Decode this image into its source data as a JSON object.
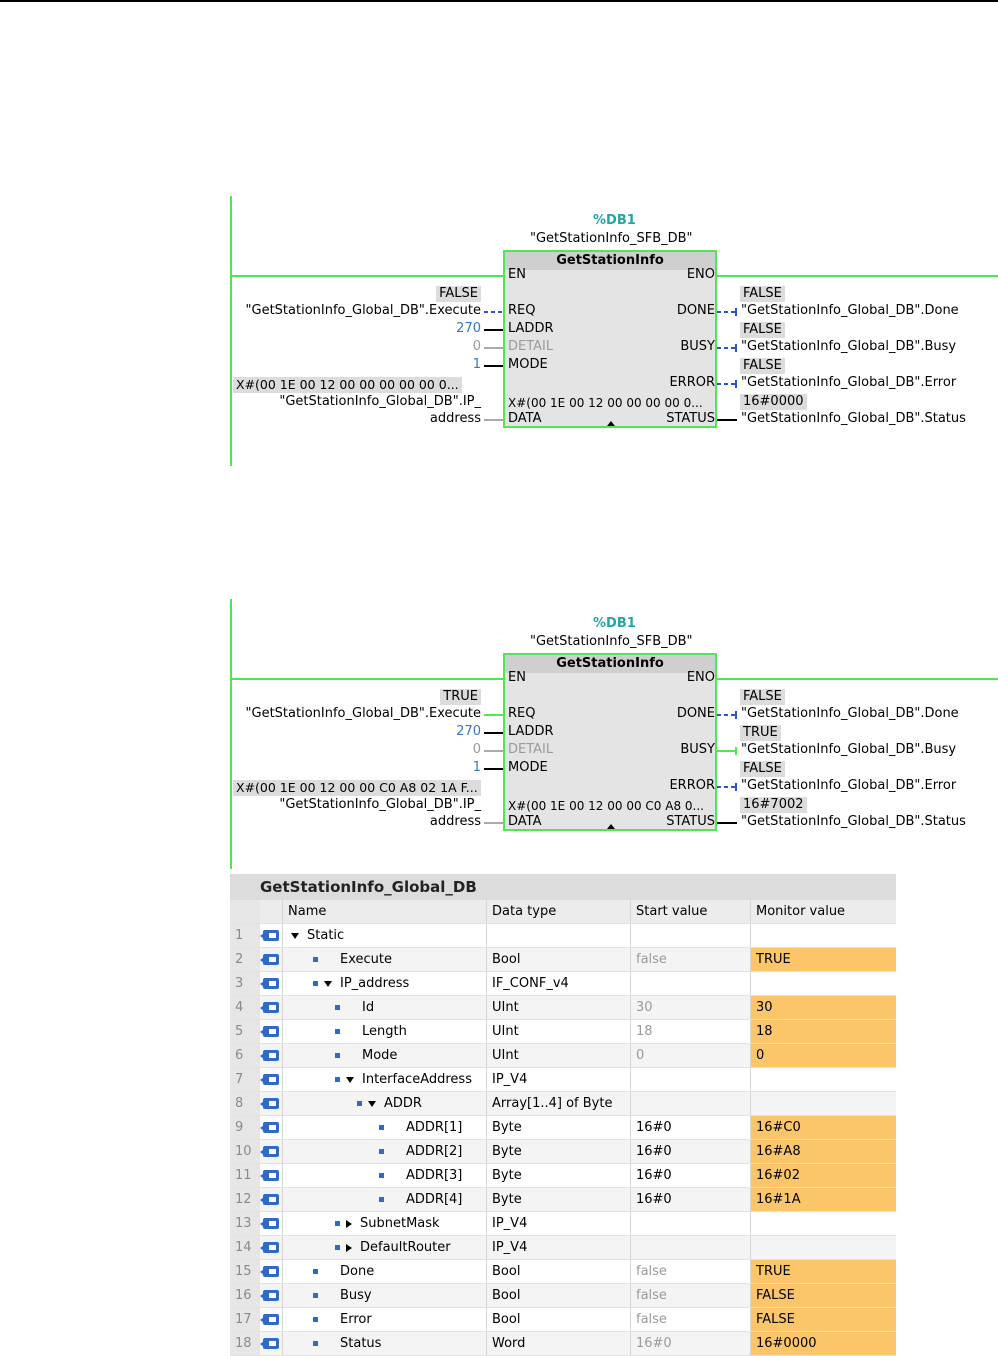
{
  "networks": [
    {
      "instance_addr": "%DB1",
      "instance_name": "\"GetStationInfo_SFB_DB\"",
      "block_title": "GetStationInfo",
      "en": "EN",
      "eno": "ENO",
      "pins_in": {
        "req": "REQ",
        "laddr": "LADDR",
        "detail": "DETAIL",
        "mode": "MODE",
        "data": "DATA"
      },
      "pins_out": {
        "done": "DONE",
        "busy": "BUSY",
        "error": "ERROR",
        "status": "STATUS"
      },
      "req_value": "FALSE",
      "req_tag": "\"GetStationInfo_Global_DB\".Execute",
      "laddr_value": "270",
      "detail_value": "0",
      "mode_value": "1",
      "data_value": "X#(00 1E 00 12 00 00 00 00 00 0...",
      "data_tag_line1": "\"GetStationInfo_Global_DB\".IP_",
      "data_tag_line2": "address",
      "data_inner": "X#(00 1E 00 12 00 00 00 00 0...",
      "done_value": "FALSE",
      "done_tag": "\"GetStationInfo_Global_DB\".Done",
      "busy_value": "FALSE",
      "busy_tag": "\"GetStationInfo_Global_DB\".Busy",
      "error_value": "FALSE",
      "error_tag": "\"GetStationInfo_Global_DB\".Error",
      "status_value": "16#0000",
      "status_tag": "\"GetStationInfo_Global_DB\".Status"
    },
    {
      "instance_addr": "%DB1",
      "instance_name": "\"GetStationInfo_SFB_DB\"",
      "block_title": "GetStationInfo",
      "en": "EN",
      "eno": "ENO",
      "pins_in": {
        "req": "REQ",
        "laddr": "LADDR",
        "detail": "DETAIL",
        "mode": "MODE",
        "data": "DATA"
      },
      "pins_out": {
        "done": "DONE",
        "busy": "BUSY",
        "error": "ERROR",
        "status": "STATUS"
      },
      "req_value": "TRUE",
      "req_tag": "\"GetStationInfo_Global_DB\".Execute",
      "laddr_value": "270",
      "detail_value": "0",
      "mode_value": "1",
      "data_value": "X#(00 1E 00 12 00 00 C0 A8 02 1A F...",
      "data_tag_line1": "\"GetStationInfo_Global_DB\".IP_",
      "data_tag_line2": "address",
      "data_inner": "X#(00 1E 00 12 00 00 C0 A8 0...",
      "done_value": "FALSE",
      "done_tag": "\"GetStationInfo_Global_DB\".Done",
      "busy_value": "TRUE",
      "busy_tag": "\"GetStationInfo_Global_DB\".Busy",
      "error_value": "FALSE",
      "error_tag": "\"GetStationInfo_Global_DB\".Error",
      "status_value": "16#7002",
      "status_tag": "\"GetStationInfo_Global_DB\".Status"
    }
  ],
  "table": {
    "title": "GetStationInfo_Global_DB",
    "headers": {
      "name": "Name",
      "type": "Data type",
      "start": "Start value",
      "monitor": "Monitor value"
    },
    "rows": [
      {
        "n": "1",
        "name": "Static",
        "type": "",
        "start": "",
        "monitor": "",
        "level": 0,
        "marker": "down",
        "bullet": false
      },
      {
        "n": "2",
        "name": "Execute",
        "type": "Bool",
        "start": "false",
        "monitor": "TRUE",
        "level": 1,
        "marker": "",
        "bullet": true
      },
      {
        "n": "3",
        "name": "IP_address",
        "type": "IF_CONF_v4",
        "start": "",
        "monitor": "",
        "level": 1,
        "marker": "down",
        "bullet": true
      },
      {
        "n": "4",
        "name": "Id",
        "type": "UInt",
        "start": "30",
        "monitor": "30",
        "level": 2,
        "marker": "",
        "bullet": true
      },
      {
        "n": "5",
        "name": "Length",
        "type": "UInt",
        "start": "18",
        "monitor": "18",
        "level": 2,
        "marker": "",
        "bullet": true
      },
      {
        "n": "6",
        "name": "Mode",
        "type": "UInt",
        "start": "0",
        "monitor": "0",
        "level": 2,
        "marker": "",
        "bullet": true
      },
      {
        "n": "7",
        "name": "InterfaceAddress",
        "type": "IP_V4",
        "start": "",
        "monitor": "",
        "level": 2,
        "marker": "down",
        "bullet": true
      },
      {
        "n": "8",
        "name": "ADDR",
        "type": "Array[1..4] of Byte",
        "start": "",
        "monitor": "",
        "level": 3,
        "marker": "down",
        "bullet": true
      },
      {
        "n": "9",
        "name": "ADDR[1]",
        "type": "Byte",
        "start": "16#0",
        "monitor": "16#C0",
        "level": 4,
        "marker": "",
        "bullet": true
      },
      {
        "n": "10",
        "name": "ADDR[2]",
        "type": "Byte",
        "start": "16#0",
        "monitor": "16#A8",
        "level": 4,
        "marker": "",
        "bullet": true
      },
      {
        "n": "11",
        "name": "ADDR[3]",
        "type": "Byte",
        "start": "16#0",
        "monitor": "16#02",
        "level": 4,
        "marker": "",
        "bullet": true
      },
      {
        "n": "12",
        "name": "ADDR[4]",
        "type": "Byte",
        "start": "16#0",
        "monitor": "16#1A",
        "level": 4,
        "marker": "",
        "bullet": true
      },
      {
        "n": "13",
        "name": "SubnetMask",
        "type": "IP_V4",
        "start": "",
        "monitor": "",
        "level": 2,
        "marker": "right",
        "bullet": true
      },
      {
        "n": "14",
        "name": "DefaultRouter",
        "type": "IP_V4",
        "start": "",
        "monitor": "",
        "level": 2,
        "marker": "right",
        "bullet": true
      },
      {
        "n": "15",
        "name": "Done",
        "type": "Bool",
        "start": "false",
        "monitor": "TRUE",
        "level": 1,
        "marker": "",
        "bullet": true
      },
      {
        "n": "16",
        "name": "Busy",
        "type": "Bool",
        "start": "false",
        "monitor": "FALSE",
        "level": 1,
        "marker": "",
        "bullet": true
      },
      {
        "n": "17",
        "name": "Error",
        "type": "Bool",
        "start": "false",
        "monitor": "FALSE",
        "level": 1,
        "marker": "",
        "bullet": true
      },
      {
        "n": "18",
        "name": "Status",
        "type": "Word",
        "start": "16#0",
        "monitor": "16#0000",
        "level": 1,
        "marker": "",
        "bullet": true
      }
    ]
  }
}
